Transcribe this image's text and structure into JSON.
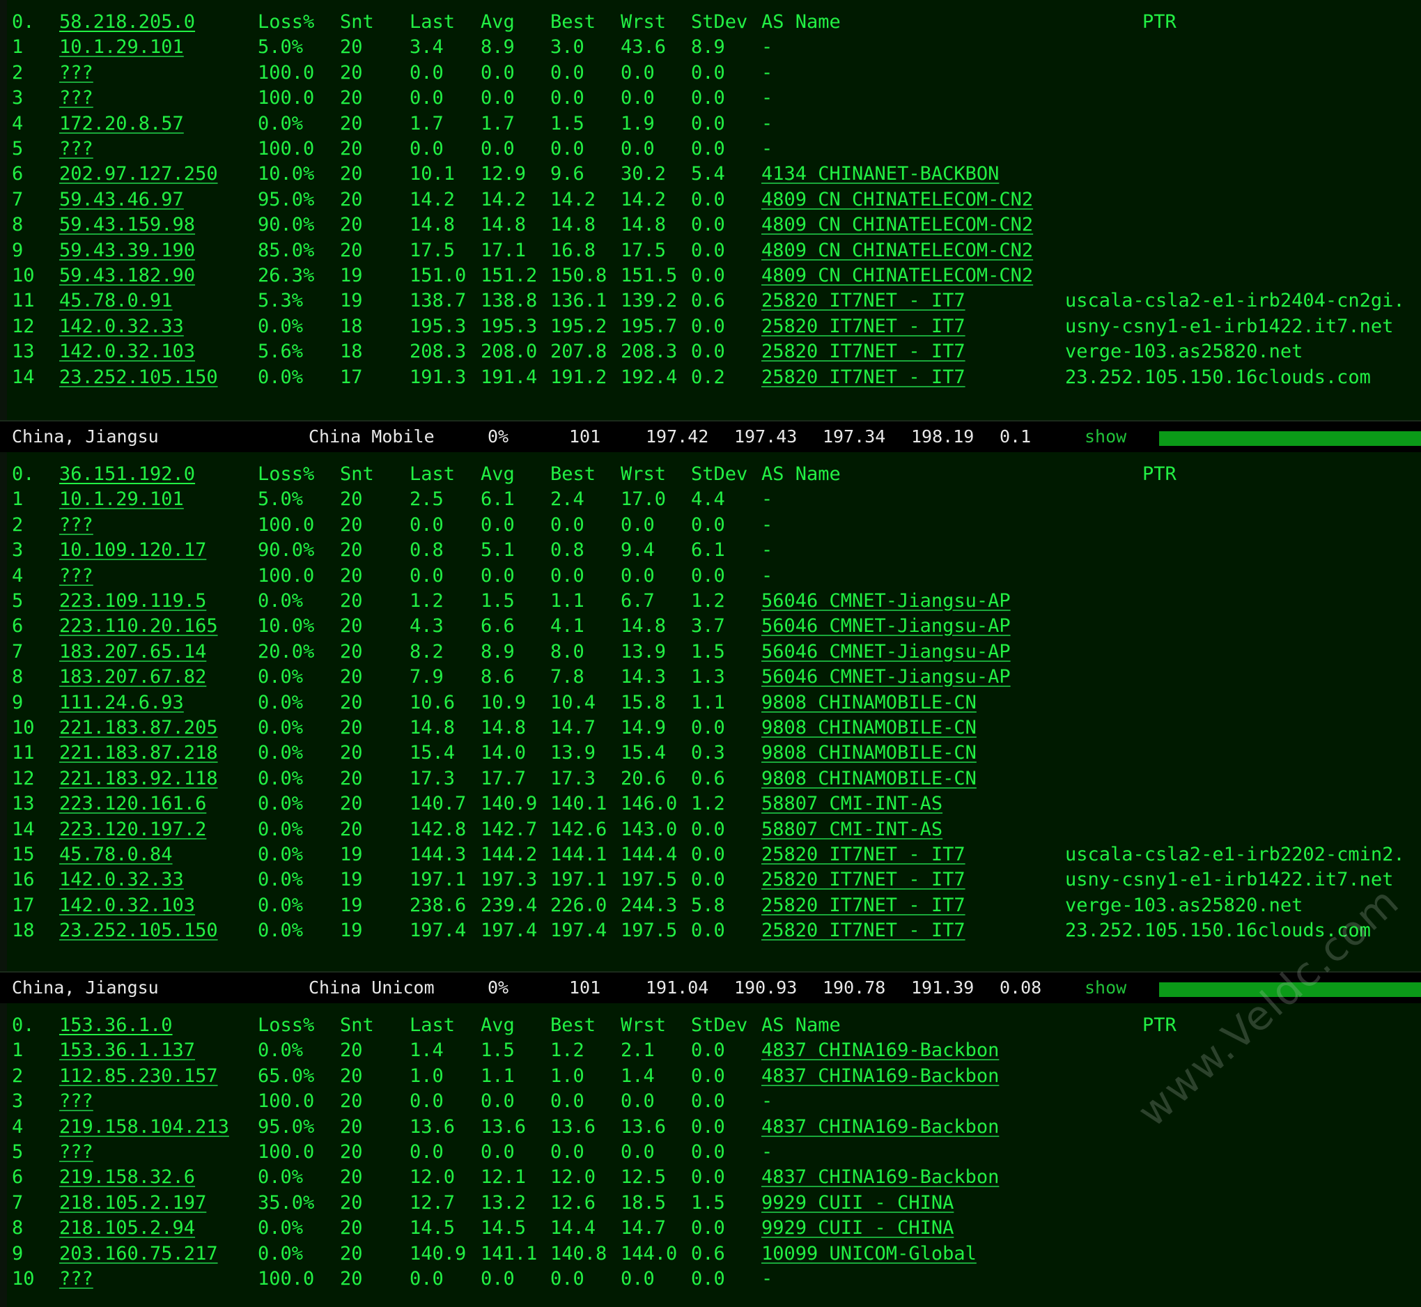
{
  "columns": {
    "loss": "Loss%",
    "snt": "Snt",
    "last": "Last",
    "avg": "Avg",
    "best": "Best",
    "wrst": "Wrst",
    "stdev": "StDev",
    "as": "AS Name",
    "ptr": "PTR"
  },
  "traces": [
    {
      "header": {
        "idx": "0.",
        "host": "58.218.205.0"
      },
      "hops": [
        {
          "idx": "1",
          "host": "10.1.29.101",
          "loss": "5.0%",
          "snt": "20",
          "last": "3.4",
          "avg": "8.9",
          "best": "3.0",
          "wrst": "43.6",
          "stdev": "8.9",
          "as": "-",
          "ptr": ""
        },
        {
          "idx": "2",
          "host": "???",
          "loss": "100.0",
          "snt": "20",
          "last": "0.0",
          "avg": "0.0",
          "best": "0.0",
          "wrst": "0.0",
          "stdev": "0.0",
          "as": "-",
          "ptr": ""
        },
        {
          "idx": "3",
          "host": "???",
          "loss": "100.0",
          "snt": "20",
          "last": "0.0",
          "avg": "0.0",
          "best": "0.0",
          "wrst": "0.0",
          "stdev": "0.0",
          "as": "-",
          "ptr": ""
        },
        {
          "idx": "4",
          "host": "172.20.8.57",
          "loss": "0.0%",
          "snt": "20",
          "last": "1.7",
          "avg": "1.7",
          "best": "1.5",
          "wrst": "1.9",
          "stdev": "0.0",
          "as": "-",
          "ptr": ""
        },
        {
          "idx": "5",
          "host": "???",
          "loss": "100.0",
          "snt": "20",
          "last": "0.0",
          "avg": "0.0",
          "best": "0.0",
          "wrst": "0.0",
          "stdev": "0.0",
          "as": "-",
          "ptr": ""
        },
        {
          "idx": "6",
          "host": "202.97.127.250",
          "loss": "10.0%",
          "snt": "20",
          "last": "10.1",
          "avg": "12.9",
          "best": "9.6",
          "wrst": "30.2",
          "stdev": "5.4",
          "as": "4134  CHINANET-BACKBON",
          "ptr": ""
        },
        {
          "idx": "7",
          "host": "59.43.46.97",
          "loss": "95.0%",
          "snt": "20",
          "last": "14.2",
          "avg": "14.2",
          "best": "14.2",
          "wrst": "14.2",
          "stdev": "0.0",
          "as": "4809  CN CHINATELECOM-CN2",
          "ptr": ""
        },
        {
          "idx": "8",
          "host": "59.43.159.98",
          "loss": "90.0%",
          "snt": "20",
          "last": "14.8",
          "avg": "14.8",
          "best": "14.8",
          "wrst": "14.8",
          "stdev": "0.0",
          "as": "4809  CN CHINATELECOM-CN2",
          "ptr": ""
        },
        {
          "idx": "9",
          "host": "59.43.39.190",
          "loss": "85.0%",
          "snt": "20",
          "last": "17.5",
          "avg": "17.1",
          "best": "16.8",
          "wrst": "17.5",
          "stdev": "0.0",
          "as": "4809  CN CHINATELECOM-CN2",
          "ptr": ""
        },
        {
          "idx": "10",
          "host": "59.43.182.90",
          "loss": "26.3%",
          "snt": "19",
          "last": "151.0",
          "avg": "151.2",
          "best": "150.8",
          "wrst": "151.5",
          "stdev": "0.0",
          "as": "4809  CN CHINATELECOM-CN2",
          "ptr": ""
        },
        {
          "idx": "11",
          "host": "45.78.0.91",
          "loss": "5.3%",
          "snt": "19",
          "last": "138.7",
          "avg": "138.8",
          "best": "136.1",
          "wrst": "139.2",
          "stdev": "0.6",
          "as": "25820 IT7NET - IT7",
          "ptr": "uscala-csla2-e1-irb2404-cn2gi."
        },
        {
          "idx": "12",
          "host": "142.0.32.33",
          "loss": "0.0%",
          "snt": "18",
          "last": "195.3",
          "avg": "195.3",
          "best": "195.2",
          "wrst": "195.7",
          "stdev": "0.0",
          "as": "25820 IT7NET - IT7",
          "ptr": "usny-csny1-e1-irb1422.it7.net"
        },
        {
          "idx": "13",
          "host": "142.0.32.103",
          "loss": "5.6%",
          "snt": "18",
          "last": "208.3",
          "avg": "208.0",
          "best": "207.8",
          "wrst": "208.3",
          "stdev": "0.0",
          "as": "25820 IT7NET - IT7",
          "ptr": "verge-103.as25820.net"
        },
        {
          "idx": "14",
          "host": "23.252.105.150",
          "loss": "0.0%",
          "snt": "17",
          "last": "191.3",
          "avg": "191.4",
          "best": "191.2",
          "wrst": "192.4",
          "stdev": "0.2",
          "as": "25820 IT7NET - IT7",
          "ptr": "23.252.105.150.16clouds.com"
        }
      ]
    },
    {
      "header": {
        "idx": "0.",
        "host": "36.151.192.0"
      },
      "hops": [
        {
          "idx": "1",
          "host": "10.1.29.101",
          "loss": "5.0%",
          "snt": "20",
          "last": "2.5",
          "avg": "6.1",
          "best": "2.4",
          "wrst": "17.0",
          "stdev": "4.4",
          "as": "-",
          "ptr": ""
        },
        {
          "idx": "2",
          "host": "???",
          "loss": "100.0",
          "snt": "20",
          "last": "0.0",
          "avg": "0.0",
          "best": "0.0",
          "wrst": "0.0",
          "stdev": "0.0",
          "as": "-",
          "ptr": ""
        },
        {
          "idx": "3",
          "host": "10.109.120.17",
          "loss": "90.0%",
          "snt": "20",
          "last": "0.8",
          "avg": "5.1",
          "best": "0.8",
          "wrst": "9.4",
          "stdev": "6.1",
          "as": "-",
          "ptr": ""
        },
        {
          "idx": "4",
          "host": "???",
          "loss": "100.0",
          "snt": "20",
          "last": "0.0",
          "avg": "0.0",
          "best": "0.0",
          "wrst": "0.0",
          "stdev": "0.0",
          "as": "-",
          "ptr": ""
        },
        {
          "idx": "5",
          "host": "223.109.119.5",
          "loss": "0.0%",
          "snt": "20",
          "last": "1.2",
          "avg": "1.5",
          "best": "1.1",
          "wrst": "6.7",
          "stdev": "1.2",
          "as": "56046 CMNET-Jiangsu-AP",
          "ptr": ""
        },
        {
          "idx": "6",
          "host": "223.110.20.165",
          "loss": "10.0%",
          "snt": "20",
          "last": "4.3",
          "avg": "6.6",
          "best": "4.1",
          "wrst": "14.8",
          "stdev": "3.7",
          "as": "56046 CMNET-Jiangsu-AP",
          "ptr": ""
        },
        {
          "idx": "7",
          "host": "183.207.65.14",
          "loss": "20.0%",
          "snt": "20",
          "last": "8.2",
          "avg": "8.9",
          "best": "8.0",
          "wrst": "13.9",
          "stdev": "1.5",
          "as": "56046 CMNET-Jiangsu-AP",
          "ptr": ""
        },
        {
          "idx": "8",
          "host": "183.207.67.82",
          "loss": "0.0%",
          "snt": "20",
          "last": "7.9",
          "avg": "8.6",
          "best": "7.8",
          "wrst": "14.3",
          "stdev": "1.3",
          "as": "56046 CMNET-Jiangsu-AP",
          "ptr": ""
        },
        {
          "idx": "9",
          "host": "111.24.6.93",
          "loss": "0.0%",
          "snt": "20",
          "last": "10.6",
          "avg": "10.9",
          "best": "10.4",
          "wrst": "15.8",
          "stdev": "1.1",
          "as": "9808  CHINAMOBILE-CN",
          "ptr": ""
        },
        {
          "idx": "10",
          "host": "221.183.87.205",
          "loss": "0.0%",
          "snt": "20",
          "last": "14.8",
          "avg": "14.8",
          "best": "14.7",
          "wrst": "14.9",
          "stdev": "0.0",
          "as": "9808  CHINAMOBILE-CN",
          "ptr": ""
        },
        {
          "idx": "11",
          "host": "221.183.87.218",
          "loss": "0.0%",
          "snt": "20",
          "last": "15.4",
          "avg": "14.0",
          "best": "13.9",
          "wrst": "15.4",
          "stdev": "0.3",
          "as": "9808  CHINAMOBILE-CN",
          "ptr": ""
        },
        {
          "idx": "12",
          "host": "221.183.92.118",
          "loss": "0.0%",
          "snt": "20",
          "last": "17.3",
          "avg": "17.7",
          "best": "17.3",
          "wrst": "20.6",
          "stdev": "0.6",
          "as": "9808  CHINAMOBILE-CN",
          "ptr": ""
        },
        {
          "idx": "13",
          "host": "223.120.161.6",
          "loss": "0.0%",
          "snt": "20",
          "last": "140.7",
          "avg": "140.9",
          "best": "140.1",
          "wrst": "146.0",
          "stdev": "1.2",
          "as": "58807 CMI-INT-AS",
          "ptr": ""
        },
        {
          "idx": "14",
          "host": "223.120.197.2",
          "loss": "0.0%",
          "snt": "20",
          "last": "142.8",
          "avg": "142.7",
          "best": "142.6",
          "wrst": "143.0",
          "stdev": "0.0",
          "as": "58807 CMI-INT-AS",
          "ptr": ""
        },
        {
          "idx": "15",
          "host": "45.78.0.84",
          "loss": "0.0%",
          "snt": "19",
          "last": "144.3",
          "avg": "144.2",
          "best": "144.1",
          "wrst": "144.4",
          "stdev": "0.0",
          "as": "25820 IT7NET - IT7",
          "ptr": "uscala-csla2-e1-irb2202-cmin2."
        },
        {
          "idx": "16",
          "host": "142.0.32.33",
          "loss": "0.0%",
          "snt": "19",
          "last": "197.1",
          "avg": "197.3",
          "best": "197.1",
          "wrst": "197.5",
          "stdev": "0.0",
          "as": "25820 IT7NET - IT7",
          "ptr": "usny-csny1-e1-irb1422.it7.net"
        },
        {
          "idx": "17",
          "host": "142.0.32.103",
          "loss": "0.0%",
          "snt": "19",
          "last": "238.6",
          "avg": "239.4",
          "best": "226.0",
          "wrst": "244.3",
          "stdev": "5.8",
          "as": "25820 IT7NET - IT7",
          "ptr": "verge-103.as25820.net"
        },
        {
          "idx": "18",
          "host": "23.252.105.150",
          "loss": "0.0%",
          "snt": "19",
          "last": "197.4",
          "avg": "197.4",
          "best": "197.4",
          "wrst": "197.5",
          "stdev": "0.0",
          "as": "25820 IT7NET - IT7",
          "ptr": "23.252.105.150.16clouds.com"
        }
      ]
    },
    {
      "header": {
        "idx": "0.",
        "host": "153.36.1.0"
      },
      "hops": [
        {
          "idx": "1",
          "host": "153.36.1.137",
          "loss": "0.0%",
          "snt": "20",
          "last": "1.4",
          "avg": "1.5",
          "best": "1.2",
          "wrst": "2.1",
          "stdev": "0.0",
          "as": "4837  CHINA169-Backbon",
          "ptr": ""
        },
        {
          "idx": "2",
          "host": "112.85.230.157",
          "loss": "65.0%",
          "snt": "20",
          "last": "1.0",
          "avg": "1.1",
          "best": "1.0",
          "wrst": "1.4",
          "stdev": "0.0",
          "as": "4837  CHINA169-Backbon",
          "ptr": ""
        },
        {
          "idx": "3",
          "host": "???",
          "loss": "100.0",
          "snt": "20",
          "last": "0.0",
          "avg": "0.0",
          "best": "0.0",
          "wrst": "0.0",
          "stdev": "0.0",
          "as": "-",
          "ptr": ""
        },
        {
          "idx": "4",
          "host": "219.158.104.213",
          "loss": "95.0%",
          "snt": "20",
          "last": "13.6",
          "avg": "13.6",
          "best": "13.6",
          "wrst": "13.6",
          "stdev": "0.0",
          "as": "4837  CHINA169-Backbon",
          "ptr": ""
        },
        {
          "idx": "5",
          "host": "???",
          "loss": "100.0",
          "snt": "20",
          "last": "0.0",
          "avg": "0.0",
          "best": "0.0",
          "wrst": "0.0",
          "stdev": "0.0",
          "as": "-",
          "ptr": ""
        },
        {
          "idx": "6",
          "host": "219.158.32.6",
          "loss": "0.0%",
          "snt": "20",
          "last": "12.0",
          "avg": "12.1",
          "best": "12.0",
          "wrst": "12.5",
          "stdev": "0.0",
          "as": "4837  CHINA169-Backbon",
          "ptr": ""
        },
        {
          "idx": "7",
          "host": "218.105.2.197",
          "loss": "35.0%",
          "snt": "20",
          "last": "12.7",
          "avg": "13.2",
          "best": "12.6",
          "wrst": "18.5",
          "stdev": "1.5",
          "as": "9929  CUII - CHINA",
          "ptr": ""
        },
        {
          "idx": "8",
          "host": "218.105.2.94",
          "loss": "0.0%",
          "snt": "20",
          "last": "14.5",
          "avg": "14.5",
          "best": "14.4",
          "wrst": "14.7",
          "stdev": "0.0",
          "as": "9929  CUII - CHINA",
          "ptr": ""
        },
        {
          "idx": "9",
          "host": "203.160.75.217",
          "loss": "0.0%",
          "snt": "20",
          "last": "140.9",
          "avg": "141.1",
          "best": "140.8",
          "wrst": "144.0",
          "stdev": "0.6",
          "as": "10099 UNICOM-Global",
          "ptr": ""
        },
        {
          "idx": "10",
          "host": "???",
          "loss": "100.0",
          "snt": "20",
          "last": "0.0",
          "avg": "0.0",
          "best": "0.0",
          "wrst": "0.0",
          "stdev": "0.0",
          "as": "-",
          "ptr": ""
        }
      ]
    }
  ],
  "summaries": [
    {
      "location": "China, Jiangsu",
      "isp": "China Mobile",
      "loss": "0%",
      "snt": "101",
      "last": "197.42",
      "avg": "197.43",
      "best": "197.34",
      "wrst": "198.19",
      "stdev": "0.1",
      "action": "show",
      "progress": 1.0
    },
    {
      "location": "China, Jiangsu",
      "isp": "China Unicom",
      "loss": "0%",
      "snt": "101",
      "last": "191.04",
      "avg": "190.93",
      "best": "190.78",
      "wrst": "191.39",
      "stdev": "0.08",
      "action": "show",
      "progress": 1.0
    }
  ],
  "watermark": "www.Veldc.com",
  "colors": {
    "text": "#22f044",
    "background": "#001b00",
    "bar_background": "#000000",
    "bar_text": "#e8e8e8",
    "progress": "#0b9a18"
  }
}
